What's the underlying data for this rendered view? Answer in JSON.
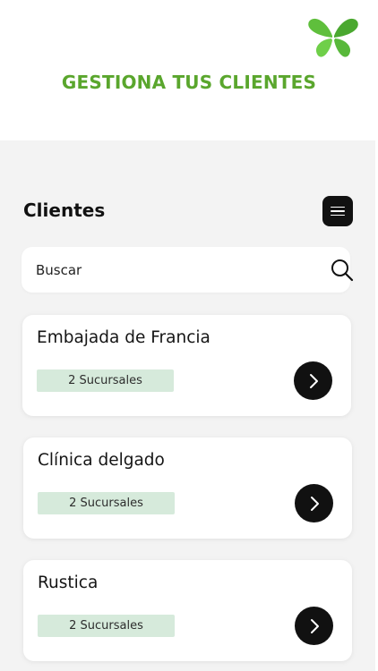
{
  "header": {
    "title": "GESTIONA TUS CLIENTES",
    "logo_icon": "butterfly-logo-icon",
    "accent_color": "#5aa62d"
  },
  "clients_section": {
    "title": "Clientes",
    "menu_icon": "hamburger-menu-icon"
  },
  "search": {
    "placeholder": "Buscar",
    "value": "",
    "icon": "search-icon"
  },
  "clients": [
    {
      "name": "Embajada de Francia",
      "branches": "2 Sucursales"
    },
    {
      "name": "Clínica delgado",
      "branches": "2 Sucursales"
    },
    {
      "name": "Rustica",
      "branches": "2 Sucursales"
    }
  ]
}
